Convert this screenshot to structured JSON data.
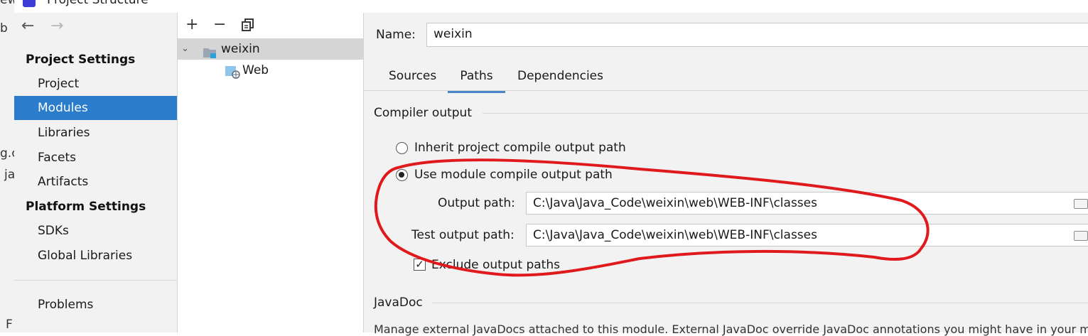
{
  "window": {
    "title": "Project Structure"
  },
  "background": {
    "fragments": [
      "ew",
      "b",
      "g.c",
      "ja",
      "F"
    ]
  },
  "nav": {
    "back_icon": "arrow-left-icon",
    "forward_icon": "arrow-right-icon",
    "project_settings_header": "Project Settings",
    "project_items": [
      {
        "label": "Project",
        "selected": false
      },
      {
        "label": "Modules",
        "selected": true
      },
      {
        "label": "Libraries",
        "selected": false
      },
      {
        "label": "Facets",
        "selected": false
      },
      {
        "label": "Artifacts",
        "selected": false
      }
    ],
    "platform_settings_header": "Platform Settings",
    "platform_items": [
      {
        "label": "SDKs"
      },
      {
        "label": "Global Libraries"
      }
    ],
    "problems_label": "Problems"
  },
  "tree_toolbar": {
    "add": "+",
    "remove": "−",
    "copy_icon": "copy-icon"
  },
  "tree": {
    "root": {
      "label": "weixin",
      "expanded": true
    },
    "children": [
      {
        "label": "Web"
      }
    ]
  },
  "module": {
    "name_label": "Name:",
    "name_value": "weixin",
    "tabs": [
      {
        "label": "Sources",
        "active": false
      },
      {
        "label": "Paths",
        "active": true
      },
      {
        "label": "Dependencies",
        "active": false
      }
    ],
    "compiler_output": {
      "header": "Compiler output",
      "inherit_label": "Inherit project compile output path",
      "use_module_label": "Use module compile output path",
      "selected_option": "use_module",
      "output_path_label": "Output path:",
      "output_path_value": "C:\\Java\\Java_Code\\weixin\\web\\WEB-INF\\classes",
      "test_output_path_label": "Test output path:",
      "test_output_path_value": "C:\\Java\\Java_Code\\weixin\\web\\WEB-INF\\classes",
      "exclude_label": "Exclude output paths",
      "exclude_checked": true
    },
    "javadoc": {
      "header": "JavaDoc",
      "description": "Manage external JavaDocs attached to this module. External JavaDoc override JavaDoc annotations you might have in your module"
    }
  },
  "colors": {
    "selection": "#2b7ccb",
    "annotation": "#e0191d",
    "tab_underline": "#4a86c8"
  }
}
